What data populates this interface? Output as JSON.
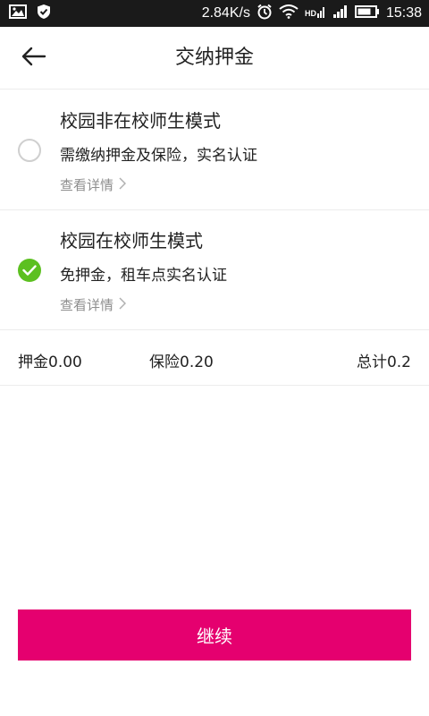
{
  "status_bar": {
    "speed": "2.84K/s",
    "time": "15:38",
    "icons": [
      "image-icon",
      "shield-icon",
      "alarm-icon",
      "wifi-icon",
      "hd-signal-icon",
      "signal-icon",
      "battery-icon"
    ]
  },
  "nav": {
    "title": "交纳押金",
    "back_icon": "arrow-left-icon"
  },
  "options": [
    {
      "title": "校园非在校师生模式",
      "desc": "需缴纳押金及保险，实名认证",
      "link": "查看详情",
      "selected": false
    },
    {
      "title": "校园在校师生模式",
      "desc": "免押金，租车点实名认证",
      "link": "查看详情",
      "selected": true
    }
  ],
  "summary": {
    "deposit": "押金0.00",
    "insurance": "保险0.20",
    "total": "总计0.2"
  },
  "continue_label": "继续",
  "colors": {
    "accent": "#e5006f",
    "check": "#5cc020",
    "status_bar": "#1a1a1a"
  }
}
